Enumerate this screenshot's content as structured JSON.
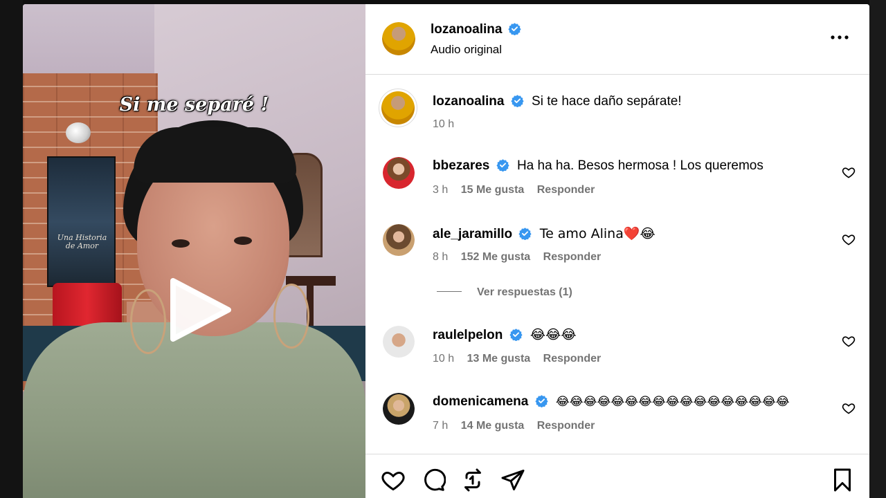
{
  "theme": {
    "accent_verified": "#3897f0",
    "text_muted": "#737373",
    "divider": "#dbdbdb"
  },
  "video": {
    "overlay_caption": "Si me separé !",
    "poster_title": "Una Historia de Amor",
    "play_icon": "play-icon"
  },
  "post_header": {
    "username": "lozanoalina",
    "subtitle": "Audio original",
    "more_icon": "more-options-icon"
  },
  "caption": {
    "username": "lozanoalina",
    "text": "Si te hace daño sepárate!",
    "time": "10 h"
  },
  "comments": [
    {
      "username": "bbezares",
      "text": "Ha ha ha. Besos hermosa ! Los queremos",
      "time": "3 h",
      "likes": "15 Me gusta",
      "reply": "Responder"
    },
    {
      "username": "ale_jaramillo",
      "text": "Te amo Alina❤️😂",
      "time": "8 h",
      "likes": "152 Me gusta",
      "reply": "Responder"
    },
    {
      "username": "raulelpelon",
      "text": "😂😂😂",
      "time": "10 h",
      "likes": "13 Me gusta",
      "reply": "Responder"
    },
    {
      "username": "domenicamena",
      "text": "😂😂😂😂😂😂😂😂😂😂😂😂😂😂😂😂😂",
      "time": "7 h",
      "likes": "14 Me gusta",
      "reply": "Responder"
    }
  ],
  "view_replies": "Ver respuestas (1)",
  "actions": [
    "heart-icon",
    "comment-icon",
    "repost-icon",
    "share-icon",
    "bookmark-icon"
  ]
}
